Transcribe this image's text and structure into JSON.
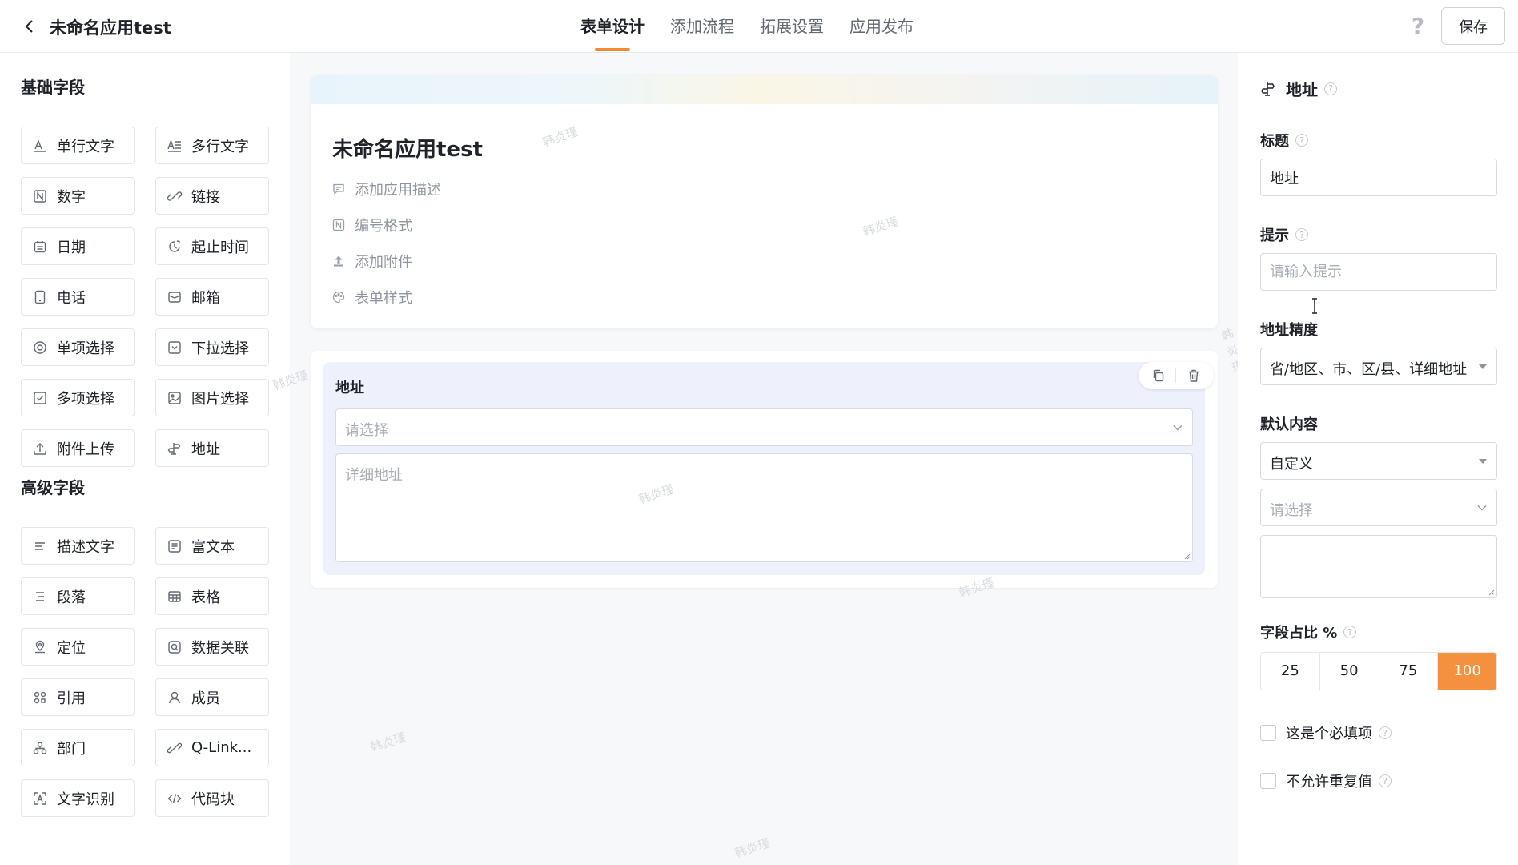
{
  "header": {
    "title": "未命名应用test",
    "tabs": [
      {
        "label": "表单设计",
        "active": true
      },
      {
        "label": "添加流程",
        "active": false
      },
      {
        "label": "拓展设置",
        "active": false
      },
      {
        "label": "应用发布",
        "active": false
      }
    ],
    "help_icon": "question-icon",
    "save_label": "保存"
  },
  "left": {
    "basic_title": "基础字段",
    "basic_fields": [
      {
        "label": "单行文字",
        "icon": "single-line-text-icon"
      },
      {
        "label": "多行文字",
        "icon": "multi-line-text-icon"
      },
      {
        "label": "数字",
        "icon": "number-icon"
      },
      {
        "label": "链接",
        "icon": "link-icon"
      },
      {
        "label": "日期",
        "icon": "calendar-icon"
      },
      {
        "label": "起止时间",
        "icon": "time-range-icon"
      },
      {
        "label": "电话",
        "icon": "phone-icon"
      },
      {
        "label": "邮箱",
        "icon": "mail-icon"
      },
      {
        "label": "单项选择",
        "icon": "radio-icon"
      },
      {
        "label": "下拉选择",
        "icon": "dropdown-icon"
      },
      {
        "label": "多项选择",
        "icon": "checkbox-icon"
      },
      {
        "label": "图片选择",
        "icon": "image-icon"
      },
      {
        "label": "附件上传",
        "icon": "upload-icon"
      },
      {
        "label": "地址",
        "icon": "signpost-icon"
      }
    ],
    "advanced_title": "高级字段",
    "advanced_fields": [
      {
        "label": "描述文字",
        "icon": "description-icon"
      },
      {
        "label": "富文本",
        "icon": "rich-text-icon"
      },
      {
        "label": "段落",
        "icon": "paragraph-icon"
      },
      {
        "label": "表格",
        "icon": "table-icon"
      },
      {
        "label": "定位",
        "icon": "location-icon"
      },
      {
        "label": "数据关联",
        "icon": "data-link-icon"
      },
      {
        "label": "引用",
        "icon": "reference-icon"
      },
      {
        "label": "成员",
        "icon": "member-icon"
      },
      {
        "label": "部门",
        "icon": "department-icon"
      },
      {
        "label": "Q-Link...",
        "icon": "qlink-icon"
      },
      {
        "label": "文字识别",
        "icon": "ocr-icon"
      },
      {
        "label": "代码块",
        "icon": "code-icon"
      }
    ]
  },
  "canvas": {
    "form_name": "未命名应用test",
    "options": [
      {
        "label": "添加应用描述",
        "icon": "comment-icon"
      },
      {
        "label": "编号格式",
        "icon": "number-format-icon"
      },
      {
        "label": "添加附件",
        "icon": "upload-icon"
      },
      {
        "label": "表单样式",
        "icon": "palette-icon"
      }
    ],
    "field": {
      "label": "地址",
      "select_placeholder": "请选择",
      "detail_placeholder": "详细地址"
    },
    "watermark": "韩炎瑾"
  },
  "props": {
    "title": "地址",
    "title_label": "标题",
    "title_value": "地址",
    "hint_label": "提示",
    "hint_placeholder": "请输入提示",
    "precision_label": "地址精度",
    "precision_value": "省/地区、市、区/县、详细地址",
    "default_label": "默认内容",
    "default_mode": "自定义",
    "default_select_placeholder": "请选择",
    "ratio_label": "字段占比 %",
    "ratios": [
      "25",
      "50",
      "75",
      "100"
    ],
    "ratio_selected": "100",
    "required_label": "这是个必填项",
    "unique_label": "不允许重复值"
  },
  "colors": {
    "accent": "#f5913e",
    "tab_underline": "#f28a35",
    "field_highlight": "#eef0fb"
  }
}
